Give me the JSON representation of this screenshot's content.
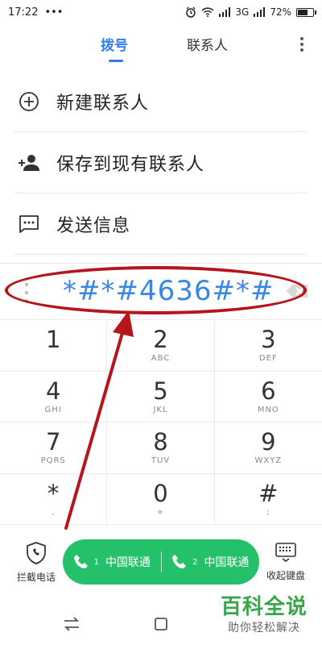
{
  "status_bar": {
    "time": "17:22",
    "dots": "•••",
    "network": "3G",
    "battery": "72%",
    "battery_level": 0.72
  },
  "tabs": [
    {
      "label": "拨号",
      "active": true
    },
    {
      "label": "联系人",
      "active": false
    }
  ],
  "actions": [
    {
      "label": "新建联系人",
      "icon": "add-circle-icon"
    },
    {
      "label": "保存到现有联系人",
      "icon": "add-person-icon"
    },
    {
      "label": "发送信息",
      "icon": "message-icon"
    }
  ],
  "dial_input": {
    "value": "*#*#4636#*#"
  },
  "keypad": [
    {
      "digit": "1",
      "letters": ""
    },
    {
      "digit": "2",
      "letters": "ABC"
    },
    {
      "digit": "3",
      "letters": "DEF"
    },
    {
      "digit": "4",
      "letters": "GHI"
    },
    {
      "digit": "5",
      "letters": "JKL"
    },
    {
      "digit": "6",
      "letters": "MNO"
    },
    {
      "digit": "7",
      "letters": "PQRS"
    },
    {
      "digit": "8",
      "letters": "TUV"
    },
    {
      "digit": "9",
      "letters": "WXYZ"
    },
    {
      "digit": "*",
      "letters": ","
    },
    {
      "digit": "0",
      "letters": "+"
    },
    {
      "digit": "#",
      "letters": ";"
    }
  ],
  "bottom": {
    "block_calls_label": "拦截电话",
    "collapse_keyboard_label": "收起键盘",
    "call_sim1": {
      "sim": "1",
      "carrier": "中国联通"
    },
    "call_sim2": {
      "sim": "2",
      "carrier": "中国联通"
    },
    "call_color": "#24c06a"
  },
  "watermark": {
    "main": "百科全说",
    "sub": "助你轻松解决"
  },
  "colors": {
    "accent": "#2e7df0",
    "annotation": "#b5151b"
  }
}
